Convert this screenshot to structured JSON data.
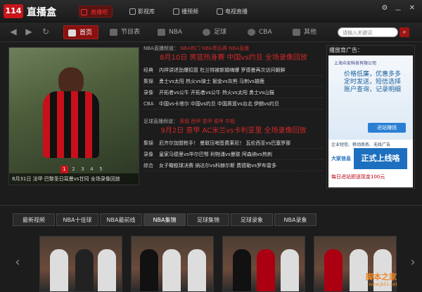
{
  "app": {
    "logo": "114",
    "name": "直播盒"
  },
  "top_tabs": [
    {
      "label": "直播吧"
    },
    {
      "label": "影视库"
    },
    {
      "label": "播预频"
    },
    {
      "label": "电视直播"
    }
  ],
  "window": {
    "settings": "⚙",
    "min": "－",
    "close": "✕"
  },
  "categories": [
    {
      "label": "首页"
    },
    {
      "label": "节目表"
    },
    {
      "label": "NBA"
    },
    {
      "label": "足球"
    },
    {
      "label": "CBA"
    },
    {
      "label": "其他"
    }
  ],
  "search": {
    "placeholder": "请输入关键词"
  },
  "hero": {
    "caption": "8月31日 法甲 巴黎圣日耳曼vs甘冈 全场录像回放",
    "pages": [
      "1",
      "2",
      "3",
      "4",
      "5"
    ]
  },
  "nba": {
    "header_label": "NBA直播频道：",
    "header_links": "NBA热门 NBA季后赛 NBA直播",
    "headline": "8月10日 男篮热身赛 中国vs约旦 全场录像回放",
    "rows": [
      {
        "label": "经典",
        "items": "内祥讲述劲爆扣篮  杜兰特被新婚嗨爆  罗德曼再次访问朝鲜"
      },
      {
        "label": "集锦",
        "items": "勇士vs太阳  热火vs骑士  掘金vs灰熊  马刺vs雄鹿"
      },
      {
        "label": "录像",
        "items": "开拓者vs公牛  开拓者vs公牛  热火vs太阳  勇士vs山猫"
      },
      {
        "label": "CBA",
        "items": "中国vs卡塔尔  中国vs约旦  中国男篮vs台北  伊朗vs约旦"
      }
    ]
  },
  "football": {
    "header_label": "足球直播频道：",
    "header_links": "英超 西甲 意甲 德甲 中超",
    "headline": "9月2日 意甲 AC米兰vs卡利亚里 全场录像回放",
    "rows": [
      {
        "label": "集锦",
        "items": "厄齐尔加盟枪手！  曼联压哨签费莱尼！  瓦伦西亚vs巴塞罗那"
      },
      {
        "label": "录像",
        "items": "皇家马德里vs毕尔巴鄂  利物浦vs曼联  阿森纳vs热刺"
      },
      {
        "label": "综合",
        "items": "女子橄榄球决赛  纳达尔vs科赫尔斯  费德勒vs罗布雷多"
      }
    ]
  },
  "ad": {
    "header": "播放育广告：",
    "line1": "上海众安科技有限公司",
    "line2": "价格低廉，优惠多多",
    "line3": "定时发送，短信选择",
    "line4": "账户查询，记录明细",
    "btn": "进站赚钱",
    "line5": "企业短信、移动商务、无线广告",
    "brand": "大家信息",
    "big": "正式上线咯",
    "promo": "每日进站即送现金100元"
  },
  "video_tabs": [
    {
      "label": "最新视频"
    },
    {
      "label": "NBA十佳球"
    },
    {
      "label": "NBA最前线"
    },
    {
      "label": "NBA集锦"
    },
    {
      "label": "足球集锦"
    },
    {
      "label": "足球录象"
    },
    {
      "label": "NBA录象"
    }
  ],
  "watermark": {
    "main": "脚本之家",
    "sub": "www.jb51.net"
  }
}
